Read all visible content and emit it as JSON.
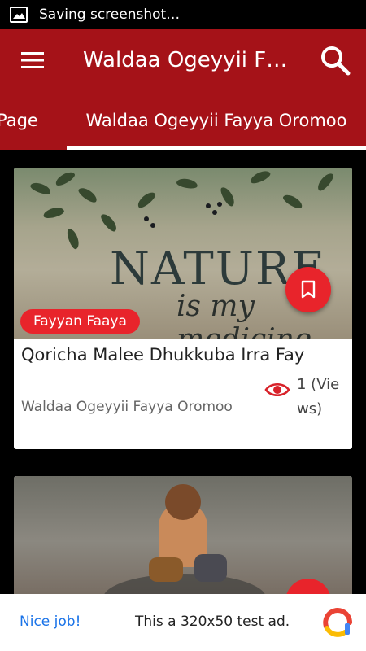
{
  "status_bar": {
    "text": "Saving screenshot…",
    "icon": "image-icon"
  },
  "app_bar": {
    "title": "Waldaa Ogeyyii F…",
    "menu_icon": "hamburger-menu-icon",
    "search_icon": "search-icon"
  },
  "tabs": [
    {
      "label": "n Page"
    },
    {
      "label": "Waldaa Ogeyyii Fayya Oromoo",
      "selected": true
    }
  ],
  "feed": {
    "cards": [
      {
        "image_text_1": "NATURE",
        "image_text_2": "is my medicine",
        "category": "Fayyan Faaya",
        "title": "Qoricha Malee Dhukkuba Irra Fay",
        "author": "Waldaa Ogeyyii Fayya Oromoo",
        "views": "1 (Views)",
        "bookmark_icon": "bookmark-icon",
        "views_icon": "eye-icon"
      },
      {
        "image_description": "child-playing-in-puddle"
      }
    ]
  },
  "ad": {
    "cta": "Nice job!",
    "text": "This a 320x50 test ad.",
    "logo_icon": "ad-choices-logo-icon"
  },
  "colors": {
    "brand": "#a51218",
    "accent": "#e8242b",
    "link": "#1a73e8"
  }
}
